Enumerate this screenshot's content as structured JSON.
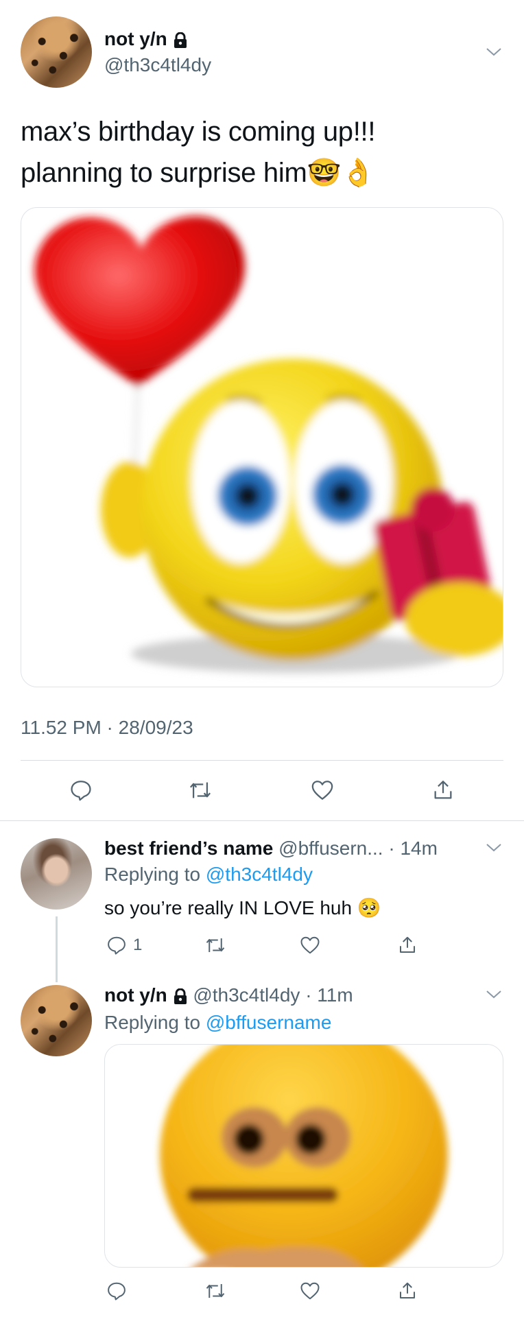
{
  "main_tweet": {
    "display_name": "not y/n",
    "handle": "@th3c4tl4dy",
    "text_line1": "max’s birthday is coming up!!!",
    "text_line2": "planning to surprise him🤓👌",
    "timestamp": "11.52 PM · 28/09/23"
  },
  "reply1": {
    "display_name": "best friend’s name",
    "handle": "@bffusern...",
    "time": "· 14m",
    "replying_prefix": "Replying to",
    "replying_to": "@th3c4tl4dy",
    "text": "so you’re really IN LOVE huh 🥺",
    "reply_count": "1"
  },
  "reply2": {
    "display_name": "not y/n",
    "handle": "@th3c4tl4dy",
    "time": "· 11m",
    "replying_prefix": "Replying to",
    "replying_to": "@bffusername"
  },
  "icons": {
    "lock": "lock-icon",
    "more": "chevron-down-icon",
    "reply": "reply-icon",
    "retweet": "retweet-icon",
    "like": "heart-icon",
    "share": "share-icon"
  },
  "colors": {
    "link": "#1d9bf0",
    "secondary_text": "#536471",
    "divider": "#d9dde1"
  }
}
